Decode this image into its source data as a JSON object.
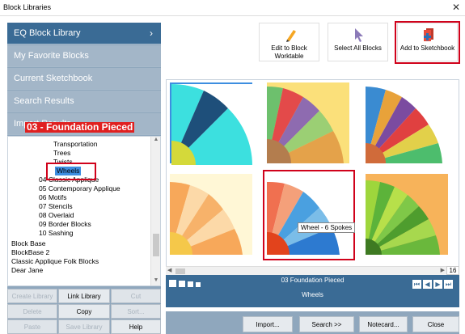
{
  "window": {
    "title": "Block Libraries",
    "close": "✕"
  },
  "nav": [
    {
      "label": "EQ Block Library",
      "chevron": "›"
    },
    {
      "label": "My Favorite Blocks"
    },
    {
      "label": "Current Sketchbook"
    },
    {
      "label": "Search Results"
    },
    {
      "label": "Import Results"
    }
  ],
  "overlay_label": "03 - Foundation Pieced",
  "tree": [
    "Transportation",
    "Trees",
    "Twists",
    "Wheels",
    "04 Classic Applique",
    "05 Contemporary Applique",
    "06 Motifs",
    "07 Stencils",
    "08 Overlaid",
    "09 Border Blocks",
    "10 Sashing",
    "Block Base",
    "BlockBase 2",
    "Classic Applique Folk Blocks",
    "Dear Jane"
  ],
  "left_buttons": [
    [
      "Create Library",
      "Link Library",
      "Cut"
    ],
    [
      "Delete",
      "Copy",
      "Sort..."
    ],
    [
      "Paste",
      "Save Library",
      "Help"
    ]
  ],
  "toolbar": {
    "edit": "Edit to Block Worktable",
    "select_all": "Select All Blocks",
    "add": "Add to Sketchbook"
  },
  "tooltip": "Wheel - 6 Spokes",
  "page_count": "16",
  "status": {
    "line1": "03 Foundation Pieced",
    "line2": "Wheels"
  },
  "bottom_buttons": {
    "import": "Import...",
    "search": "Search  >>",
    "notecard": "Notecard...",
    "close": "Close"
  },
  "colors": {
    "accent": "#3a6b95",
    "panel": "#8fa7bd",
    "highlight_red": "#d0021b"
  }
}
